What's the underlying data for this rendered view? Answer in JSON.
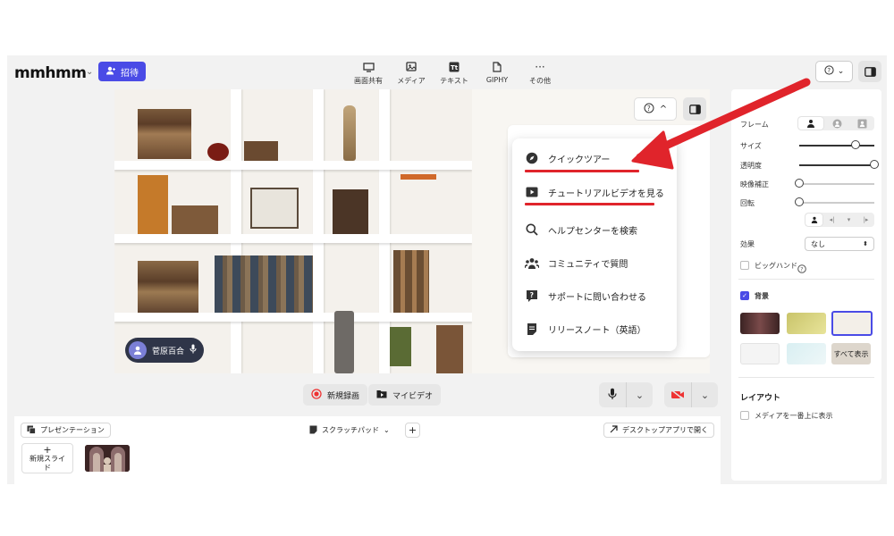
{
  "app": {
    "logo": "mmhmm",
    "invite_label": "招待"
  },
  "toolbar": [
    {
      "label": "画面共有",
      "icon": "monitor-icon"
    },
    {
      "label": "メディア",
      "icon": "media-icon"
    },
    {
      "label": "テキスト",
      "icon": "text-icon"
    },
    {
      "label": "GIPHY",
      "icon": "giphy-icon"
    },
    {
      "label": "その他",
      "icon": "more-icon"
    }
  ],
  "presenter": {
    "name": "菅原百合"
  },
  "help_menu": {
    "items": [
      {
        "label": "クイックツアー",
        "icon": "compass-icon",
        "underlined": true
      },
      {
        "label": "チュートリアルビデオを見る",
        "icon": "play-icon",
        "underlined": true
      },
      {
        "label": "ヘルプセンターを検索",
        "icon": "search-icon",
        "underlined": false
      },
      {
        "label": "コミュニティで質問",
        "icon": "community-icon",
        "underlined": false
      },
      {
        "label": "サポートに問い合わせる",
        "icon": "chat-question-icon",
        "underlined": false
      },
      {
        "label": "リリースノート（英語）",
        "icon": "notes-icon",
        "underlined": false
      }
    ]
  },
  "controls": {
    "record_label": "新規録画",
    "my_video_label": "マイビデオ"
  },
  "tray": {
    "presentation_label": "プレゼンテーション",
    "scratchpad_label": "スクラッチパッド",
    "desktop_app_label": "デスクトップアプリで開く",
    "new_slide_plus": "+",
    "new_slide_label": "新規スライド"
  },
  "right_panel": {
    "frame_label": "フレーム",
    "size_label": "サイズ",
    "size_value": 0.75,
    "opacity_label": "透明度",
    "opacity_value": 1.0,
    "video_correction_label": "映像補正",
    "video_correction_value": 0.0,
    "rotation_label": "回転",
    "rotation_value": 0.0,
    "effect_label": "効果",
    "effect_value": "なし",
    "big_hands_label": "ビッグハンド",
    "background_label": "背景",
    "show_all_label": "すべて表示",
    "layout_title": "レイアウト",
    "media_on_top_label": "メディアを一番上に表示"
  },
  "colors": {
    "accent": "#4a4be6",
    "annotation_red": "#e0242b"
  }
}
